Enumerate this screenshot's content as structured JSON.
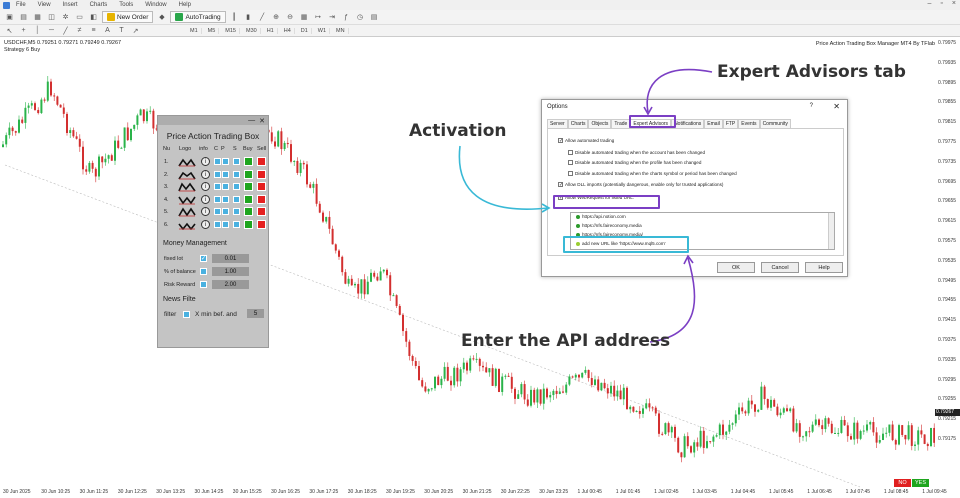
{
  "menu": {
    "items": [
      "File",
      "View",
      "Insert",
      "Charts",
      "Tools",
      "Window",
      "Help"
    ]
  },
  "toolbar": {
    "new_order": "New Order",
    "autotrading": "AutoTrading"
  },
  "timeframes": [
    "M1",
    "M5",
    "M15",
    "M30",
    "H1",
    "H4",
    "D1",
    "W1",
    "MN"
  ],
  "chart": {
    "symbol_line": "USDCHF,M5  0.79251 0.79271 0.79249 0.79267",
    "strategy_line": "Strategy 6 Buy",
    "title": "Price Action Trading Box Manager MT4 By TFlab",
    "current_price": "0.79267",
    "no_label": "NO",
    "yes_label": "YES",
    "price_labels": [
      "0.79975",
      "0.79935",
      "0.79895",
      "0.79855",
      "0.79815",
      "0.79775",
      "0.79735",
      "0.79695",
      "0.79655",
      "0.79615",
      "0.79575",
      "0.79535",
      "0.79495",
      "0.79455",
      "0.79415",
      "0.79375",
      "0.79335",
      "0.79295",
      "0.79255",
      "0.79215",
      "0.79175"
    ],
    "time_labels": [
      "30 Jun 2025",
      "30 Jun 10:25",
      "30 Jun 11:25",
      "30 Jun 12:25",
      "30 Jun 13:25",
      "30 Jun 14:25",
      "30 Jun 15:25",
      "30 Jun 16:25",
      "30 Jun 17:25",
      "30 Jun 18:25",
      "30 Jun 19:25",
      "30 Jun 20:25",
      "30 Jun 21:25",
      "30 Jun 22:25",
      "30 Jun 23:25",
      "1 Jul 00:45",
      "1 Jul 01:45",
      "1 Jul 02:45",
      "1 Jul 03:45",
      "1 Jul 04:45",
      "1 Jul 05:45",
      "1 Jul 06:45",
      "1 Jul 07:45",
      "1 Jul 08:45",
      "1 Jul 09:45"
    ],
    "colors": {
      "bull": "#2ab34a",
      "bear": "#d32f2f"
    }
  },
  "panel": {
    "title": "Price Action Trading Box",
    "headers": [
      "Nu",
      "Logo",
      "info",
      "C",
      "P",
      "S",
      "Buy",
      "Sell"
    ],
    "rows": [
      "1.",
      "2.",
      "3.",
      "4.",
      "5.",
      "6."
    ],
    "info_glyph": "i",
    "money_title": "Money Management",
    "money": [
      {
        "label": "fixed lot",
        "value": "0.01",
        "checked": true
      },
      {
        "label": "% of balance",
        "value": "1.00",
        "checked": false
      },
      {
        "label": "Risk Reward",
        "value": "2.00",
        "checked": false
      }
    ],
    "checkmark": "✓",
    "news_title": "News Filte",
    "filter_label": "filter",
    "filter_text": "X min bef. and",
    "filter_value": "5",
    "minimize": "—",
    "close": "✕"
  },
  "dialog": {
    "title": "Options",
    "help_q": "?",
    "close": "✕",
    "tabs": [
      "Server",
      "Charts",
      "Objects",
      "Trade",
      "Expert Advisors",
      "Notifications",
      "Email",
      "FTP",
      "Events",
      "Community"
    ],
    "active_tab": "Expert Advisors",
    "options": [
      {
        "label": "Allow automated trading",
        "checked": true
      },
      {
        "label": "Disable automated trading when the account has been changed",
        "checked": false
      },
      {
        "label": "Disable automated trading when the profile has been changed",
        "checked": false
      },
      {
        "label": "Disable automated trading when the charts symbol or period has been changed",
        "checked": false
      },
      {
        "label": "Allow DLL imports (potentially dangerous, enable only for trusted applications)",
        "checked": true
      },
      {
        "label": "Allow WebRequest for listed URL:",
        "checked": true
      }
    ],
    "urls": [
      "https://api.notion.com",
      "https://nfs.faireconomy.media",
      "https://nfs.faireconomy.media/"
    ],
    "add_url": "add new URL like 'https://www.mql5.com'",
    "ok": "OK",
    "cancel": "Cancel",
    "help": "Help"
  },
  "annotations": {
    "expert_tab": "Expert Advisors tab",
    "activation": "Activation",
    "enter_api": "Enter the API address",
    "colors": {
      "purple": "#7b3fc4",
      "cyan": "#39b9d6"
    }
  }
}
